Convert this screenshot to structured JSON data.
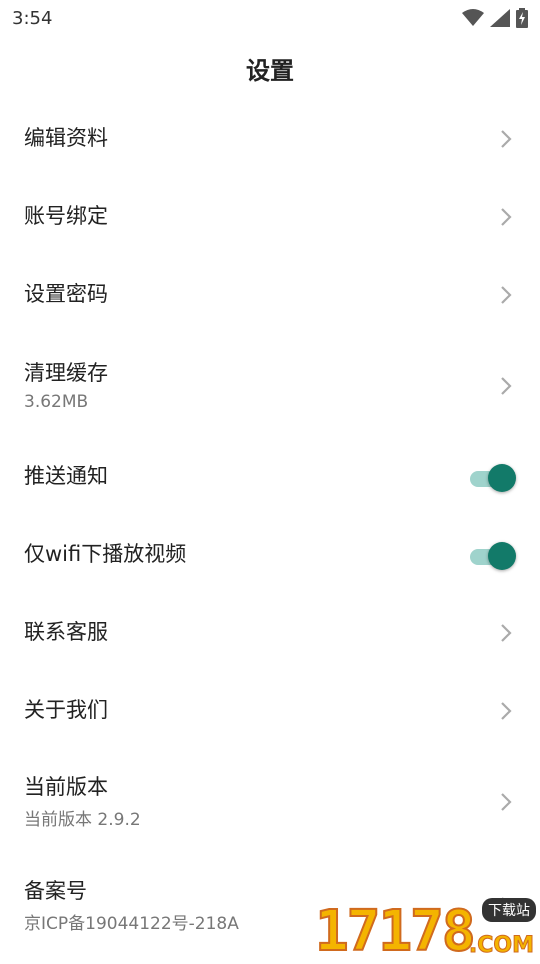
{
  "status_bar": {
    "time": "3:54",
    "icons": [
      "wifi-icon",
      "signal-icon",
      "battery-charging-icon"
    ]
  },
  "header": {
    "title": "设置"
  },
  "settings": {
    "edit_profile": {
      "label": "编辑资料"
    },
    "account_binding": {
      "label": "账号绑定"
    },
    "set_password": {
      "label": "设置密码"
    },
    "clear_cache": {
      "label": "清理缓存",
      "value": "3.62MB"
    },
    "push_notifications": {
      "label": "推送通知",
      "enabled": true
    },
    "wifi_only_video": {
      "label": "仅wifi下播放视频",
      "enabled": true
    },
    "contact_support": {
      "label": "联系客服"
    },
    "about_us": {
      "label": "关于我们"
    },
    "current_version": {
      "label": "当前版本",
      "value": "当前版本 2.9.2"
    },
    "icp_record": {
      "label": "备案号",
      "value": "京ICP备19044122号-218A"
    }
  },
  "colors": {
    "toggle_thumb": "#127a69",
    "toggle_track": "#9fd3cc",
    "chevron": "#aaaaaa"
  },
  "watermark": {
    "digits": "17178",
    "badge": "下载站",
    "suffix": ".COM"
  }
}
